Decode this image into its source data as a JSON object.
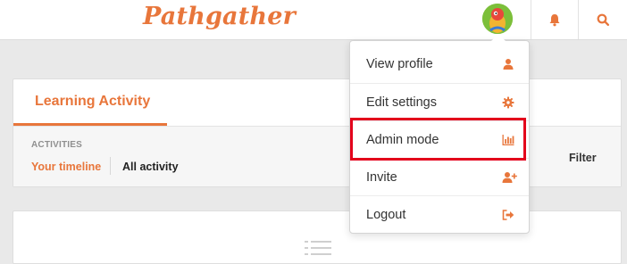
{
  "header": {
    "logo_text": "Pathgather",
    "avatar_icon": "avatar-image",
    "notifications_icon": "bell-icon",
    "search_icon": "search-icon"
  },
  "activity_card": {
    "title": "Learning Activity",
    "activities_label": "ACTIVITIES",
    "tabs": [
      {
        "label": "Your timeline",
        "active": true
      },
      {
        "label": "All activity",
        "active": false
      }
    ],
    "filter_label": "Filter"
  },
  "user_menu": {
    "items": [
      {
        "label": "View profile",
        "icon": "user-icon"
      },
      {
        "label": "Edit settings",
        "icon": "gear-icon"
      },
      {
        "label": "Admin mode",
        "icon": "bar-chart-icon",
        "highlighted": true
      },
      {
        "label": "Invite",
        "icon": "user-plus-icon"
      },
      {
        "label": "Logout",
        "icon": "sign-out-icon"
      }
    ]
  },
  "colors": {
    "accent": "#e8763b",
    "highlight_border": "#e3001b",
    "background": "#e9e9e9"
  }
}
